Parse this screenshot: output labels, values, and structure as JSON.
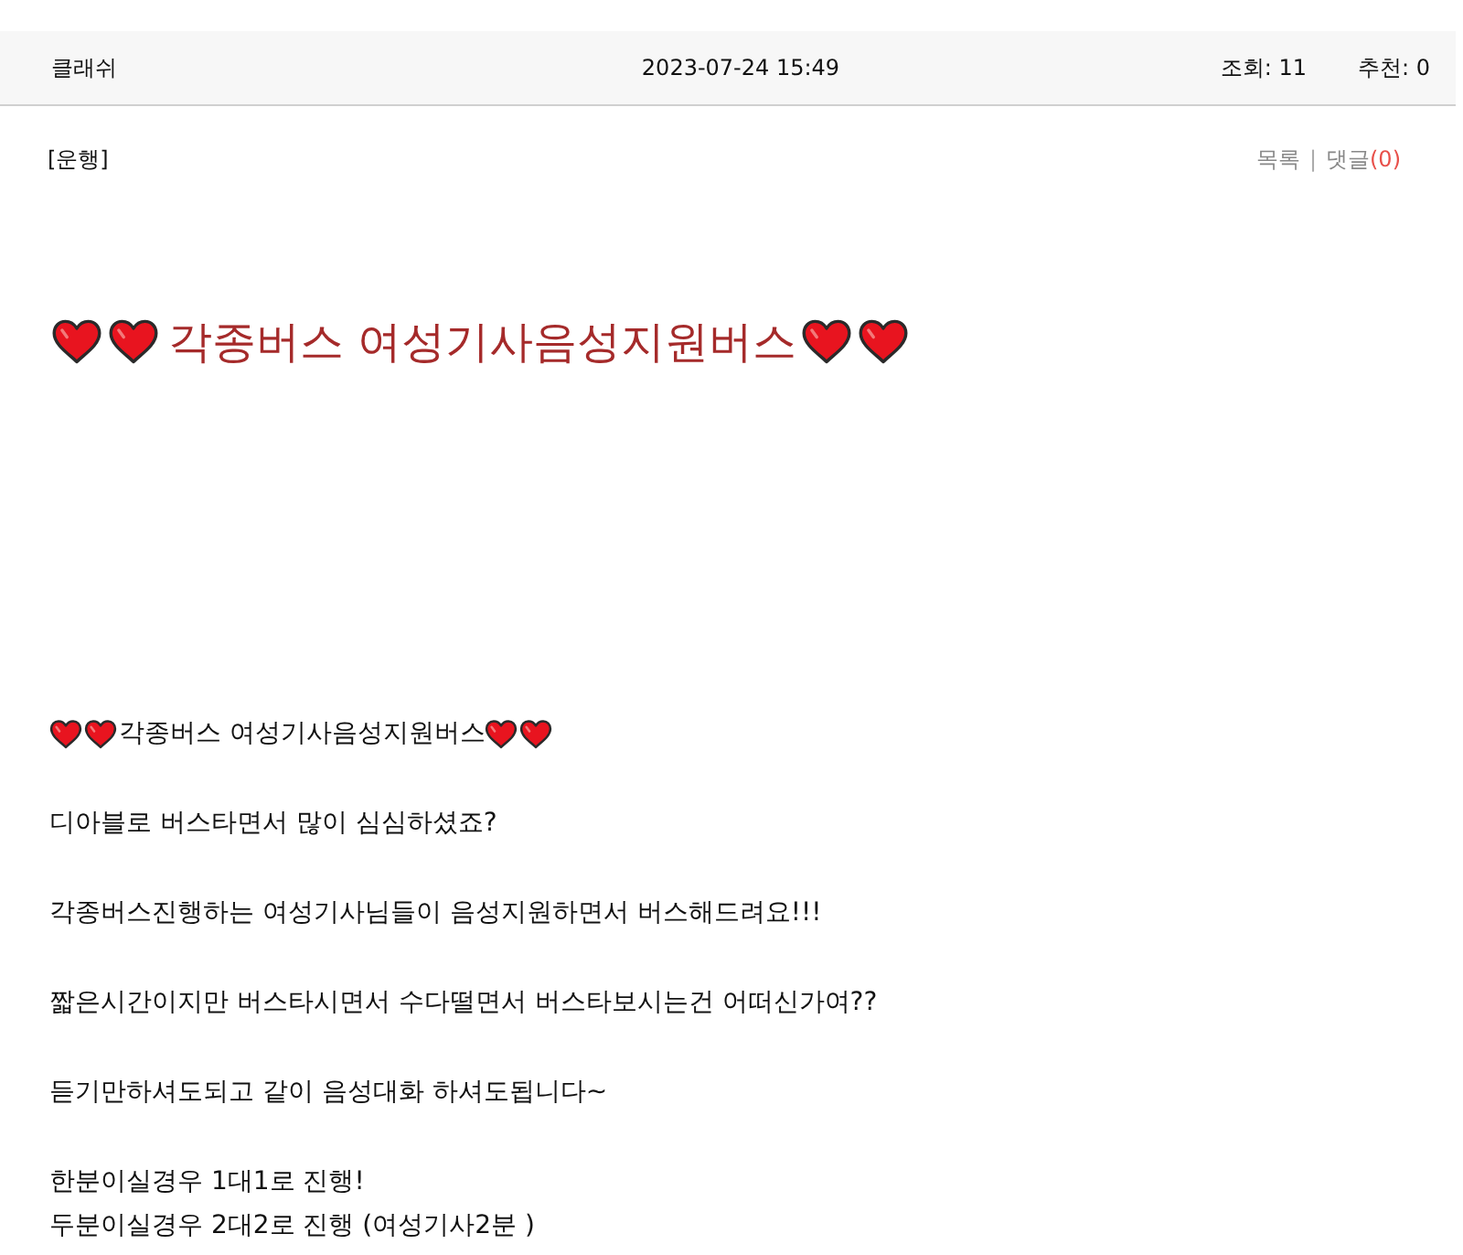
{
  "header": {
    "author": "클래쉬",
    "date": "2023-07-24 15:49",
    "views": "조회: 11",
    "recommends": "추천: 0"
  },
  "post_bar": {
    "category": "[운행]",
    "list_link": "목록",
    "separator": "|",
    "comment_link": {
      "label": "댓글",
      "count": "(0)"
    }
  },
  "title": {
    "kind": "hearts",
    "text": "각종버스 여성기사음성지원버스"
  },
  "body": [
    {
      "kind": "hearts",
      "lines": [
        "각종버스 여성기사음성지원버스"
      ]
    },
    {
      "kind": "plain",
      "lines": [
        "디아블로 버스타면서 많이 심심하셨죠?"
      ]
    },
    {
      "kind": "plain",
      "lines": [
        "각종버스진행하는 여성기사님들이 음성지원하면서 버스해드려요!!!"
      ]
    },
    {
      "kind": "plain",
      "lines": [
        "짧은시간이지만 버스타시면서 수다떨면서 버스타보시는건 어떠신가여??"
      ]
    },
    {
      "kind": "plain",
      "lines": [
        "듣기만하셔도되고 같이 음성대화 하셔도됩니다~"
      ]
    },
    {
      "kind": "plain",
      "lines": [
        "한분이실경우 1대1로 진행!",
        "두분이실경우 2대2로 진행 (여성기사2분 )"
      ]
    }
  ]
}
